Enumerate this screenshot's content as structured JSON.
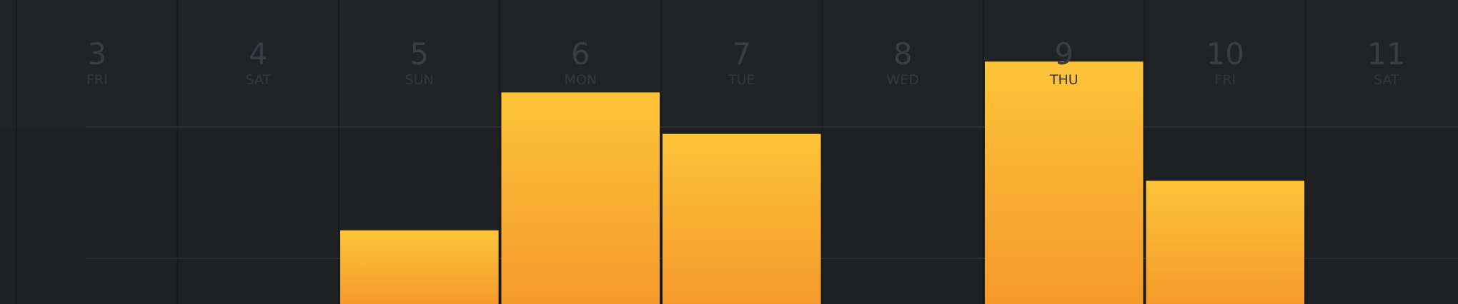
{
  "colors": {
    "background": "#1e2024",
    "header_background": "#212327",
    "grid_line": "#2a2d32",
    "bar_top": "#fdc43a",
    "bar_bottom": "#f59a2b",
    "label_text": "#3a3d43"
  },
  "chart_data": {
    "type": "bar",
    "title": "",
    "xlabel": "",
    "ylabel": "",
    "grid": true,
    "categories": [
      {
        "day": "3",
        "weekday": "FRI"
      },
      {
        "day": "4",
        "weekday": "SAT"
      },
      {
        "day": "5",
        "weekday": "SUN"
      },
      {
        "day": "6",
        "weekday": "MON"
      },
      {
        "day": "7",
        "weekday": "TUE"
      },
      {
        "day": "8",
        "weekday": "WED"
      },
      {
        "day": "9",
        "weekday": "THU"
      },
      {
        "day": "10",
        "weekday": "FRI"
      },
      {
        "day": "11",
        "weekday": "SAT"
      }
    ],
    "values": [
      0,
      0,
      0.55,
      1.58,
      1.27,
      0,
      1.81,
      0.92,
      0
    ],
    "ylim": [
      0,
      2.27
    ]
  }
}
